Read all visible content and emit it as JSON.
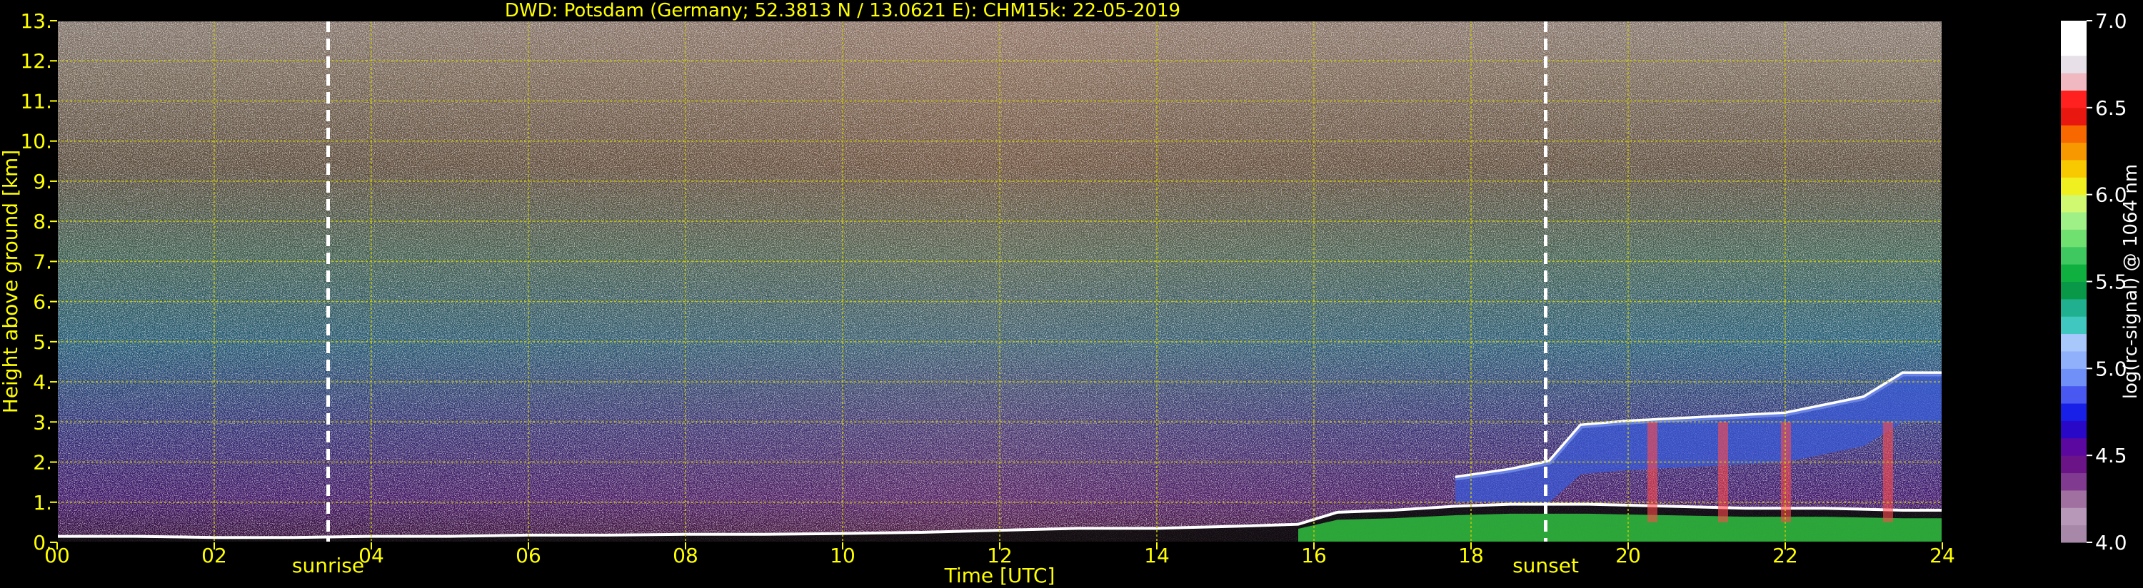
{
  "chart_data": {
    "type": "heatmap",
    "title": "DWD: Potsdam (Germany; 52.3813 N / 13.0621 E):    CHM15k: 22-05-2019",
    "xlabel": "Time [UTC]",
    "ylabel": "Height above ground [km]",
    "colorbar_label": "log(rc-signal) @ 1064 nm",
    "xlim": [
      0,
      24
    ],
    "ylim": [
      0,
      13
    ],
    "x_ticks": [
      0,
      2,
      4,
      6,
      8,
      10,
      12,
      14,
      16,
      18,
      20,
      22,
      24
    ],
    "x_tick_labels": [
      "00",
      "02",
      "04",
      "06",
      "08",
      "10",
      "12",
      "14",
      "16",
      "18",
      "20",
      "22",
      "24"
    ],
    "y_ticks": [
      0,
      1,
      2,
      3,
      4,
      5,
      6,
      7,
      8,
      9,
      10,
      11,
      12,
      13
    ],
    "y_tick_labels": [
      "0.",
      "1.",
      "2.",
      "3.",
      "4.",
      "5.",
      "6.",
      "7.",
      "8.",
      "9.",
      "10.",
      "11.",
      "12.",
      "13."
    ],
    "grid": true,
    "clim": [
      4.0,
      7.0
    ],
    "colorbar_ticks": [
      4.0,
      4.5,
      5.0,
      5.5,
      6.0,
      6.5,
      7.0
    ],
    "colorbar_tick_labels": [
      "4.0",
      "4.5",
      "5.0",
      "5.5",
      "6.0",
      "6.5",
      "7.0"
    ],
    "colorbar_colors": [
      "#a888a8",
      "#b898b8",
      "#a070a0",
      "#803a90",
      "#6a1488",
      "#5a08a0",
      "#2a08c8",
      "#1820e8",
      "#4858f0",
      "#7090f8",
      "#90b0fc",
      "#a8c8fc",
      "#40c8c0",
      "#20b090",
      "#089848",
      "#10b040",
      "#40c860",
      "#70e070",
      "#a0f088",
      "#d0f870",
      "#f0f020",
      "#f8c800",
      "#f89800",
      "#f86800",
      "#e81810",
      "#ff2020",
      "#f0b8c0",
      "#e8e0e8",
      "#ffffff",
      "#ffffff"
    ],
    "markers": [
      {
        "label": "sunrise",
        "time": 3.45
      },
      {
        "label": "sunset",
        "time": 18.95
      }
    ],
    "series": [
      {
        "name": "",
        "x": [
          0,
          1,
          2,
          3,
          4,
          5,
          6,
          7,
          8,
          9,
          10,
          11,
          12,
          13,
          14,
          15,
          15.8,
          16.3,
          17,
          17.8,
          18.5,
          19.5,
          20.5,
          21.5,
          22.5,
          23.5,
          24
        ],
        "values": [
          0.15,
          0.15,
          0.12,
          0.12,
          0.15,
          0.15,
          0.18,
          0.18,
          0.2,
          0.2,
          0.22,
          0.25,
          0.3,
          0.35,
          0.35,
          0.4,
          0.45,
          0.75,
          0.8,
          0.9,
          0.95,
          0.95,
          0.9,
          0.85,
          0.85,
          0.8,
          0.8
        ]
      },
      {
        "name": "",
        "x": [
          17.8,
          18.5,
          19.0,
          19.4,
          20.0,
          21.0,
          22.0,
          23.0,
          23.5,
          24.0
        ],
        "values": [
          1.6,
          1.8,
          2.0,
          2.9,
          3.0,
          3.1,
          3.2,
          3.6,
          4.2,
          4.2
        ]
      }
    ]
  },
  "colors": {
    "text": "#ffff00",
    "grid": "#c8c800",
    "marker": "#ffffff",
    "background": "#000000"
  }
}
